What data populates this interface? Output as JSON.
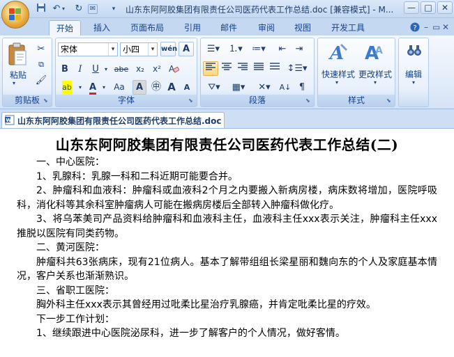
{
  "window": {
    "title": "山东东阿阿胶集团有限责任公司医药代表工作总结.doc [兼容模式] - M...",
    "controls": [
      "—",
      "□",
      "✕"
    ]
  },
  "quick_access": [
    "save-icon",
    "undo-icon",
    "redo-icon",
    "customize-icon"
  ],
  "ribbon": {
    "tabs": [
      "开始",
      "插入",
      "页面布局",
      "引用",
      "邮件",
      "审阅",
      "视图",
      "开发工具"
    ],
    "active_tab": "开始",
    "groups": {
      "clipboard": {
        "label": "剪贴板",
        "paste": "粘贴"
      },
      "font": {
        "label": "字体",
        "font_name": "宋体",
        "font_size": "小四",
        "buttons": [
          "B",
          "I",
          "U",
          "abe",
          "x₂",
          "x²",
          "Aa",
          "A",
          "A",
          "A",
          "A"
        ]
      },
      "paragraph": {
        "label": "段落"
      },
      "styles": {
        "label": "样式",
        "quick_styles": "快速样式",
        "change_styles": "更改样式"
      },
      "editing": {
        "label": "编辑"
      }
    },
    "accent_color": "#15428b"
  },
  "document_tab": {
    "label": "山东东阿阿胶集团有限责任公司医药代表工作总结.doc"
  },
  "document": {
    "title": "山东东阿阿胶集团有限责任公司医药代表工作总结(二)",
    "paragraphs": [
      "一、中心医院：",
      "1、乳腺科：乳腺一科和二科近期可能要合并。",
      "2、肿瘤科和血液科：肿瘤科或血液科2个月之内要搬入新病房楼，病床数将增加，医院呼吸科，消化科等其余科室肿瘤病人可能在搬病房楼后全部转入肿瘤科做化疗。",
      "3、将乌苯美司产品资料给肿瘤科和血液科主任，血液科主任xxx表示关注，肿瘤科主任xxx推脱以医院有同类药物。",
      "二、黄河医院：",
      "肿瘤科共63张病床，现有21位病人。基本了解带组组长梁星丽和魏向东的个人及家庭基本情况，客户关系也渐渐熟识。",
      "三、省职工医院：",
      "胸外科主任xxx表示其曾经用过吡柔比星治疗乳腺癌，并肯定吡柔比星的疗效。",
      "下一步工作计划：",
      "1、继续跟进中心医院泌尿科，进一步了解客户的个人情况，做好客情。"
    ]
  }
}
